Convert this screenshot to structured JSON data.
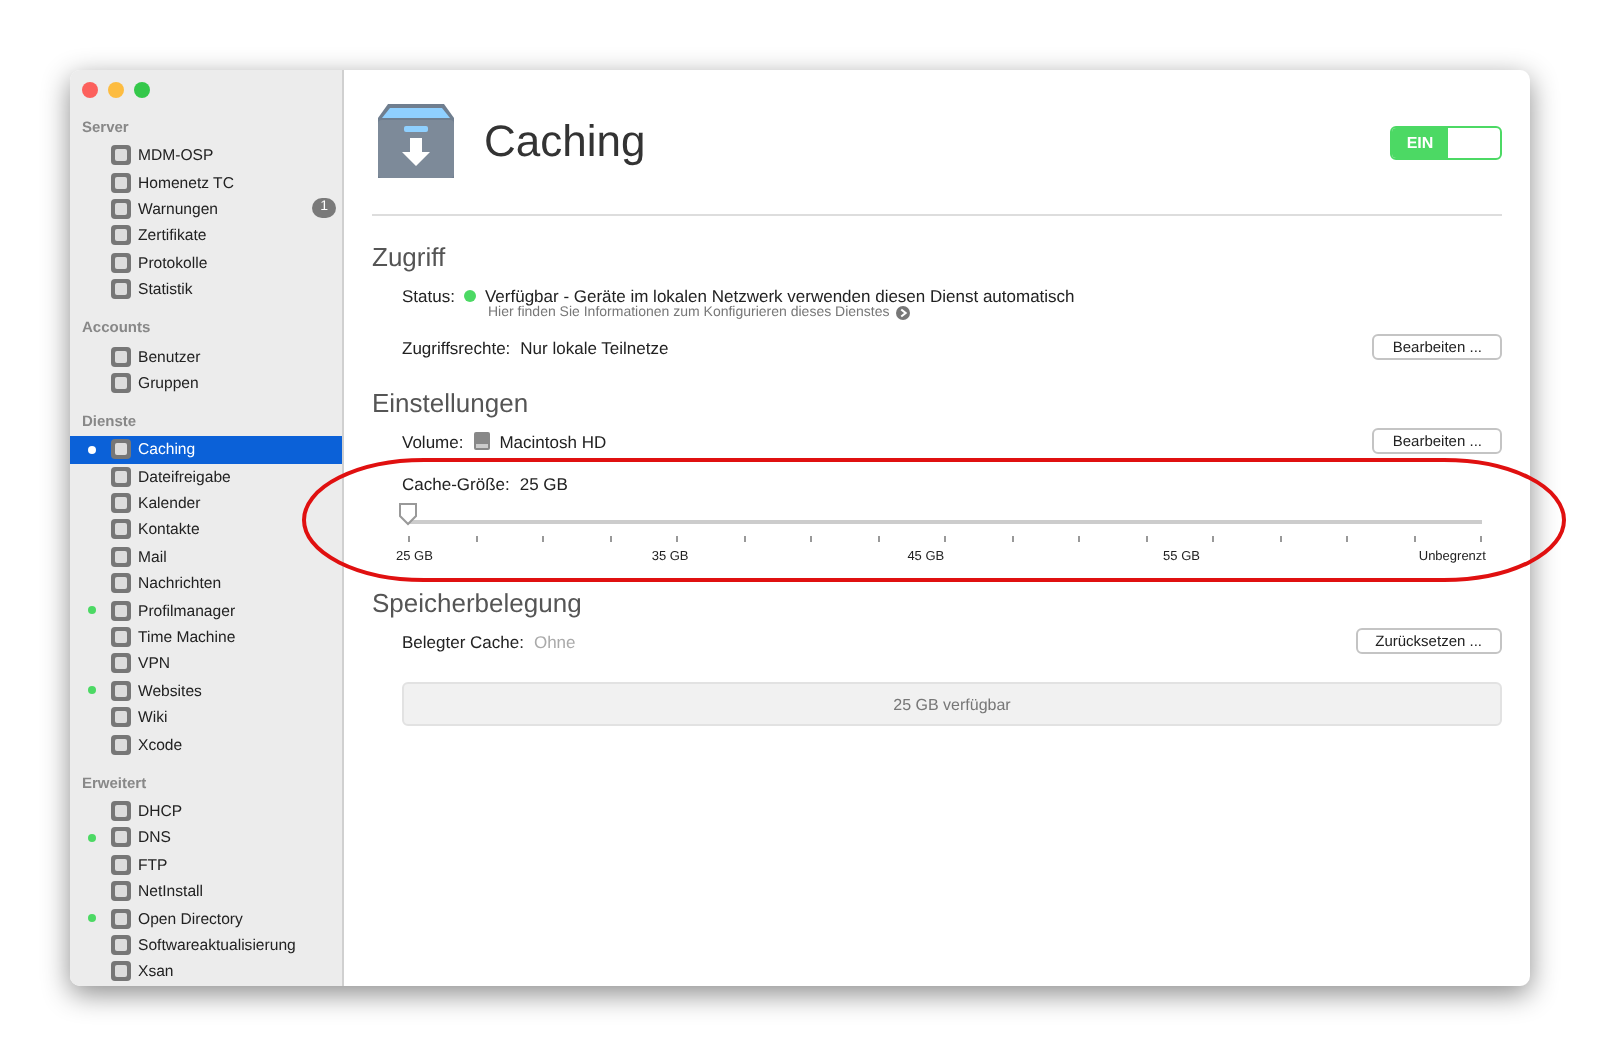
{
  "sidebar": {
    "sections": [
      {
        "title": "Server",
        "items": [
          {
            "label": "MDM-OSP",
            "selected": false,
            "running": false
          },
          {
            "label": "Homenetz TC",
            "selected": false,
            "running": false
          },
          {
            "label": "Warnungen",
            "selected": false,
            "running": false,
            "badge": "1"
          },
          {
            "label": "Zertifikate",
            "selected": false,
            "running": false
          },
          {
            "label": "Protokolle",
            "selected": false,
            "running": false
          },
          {
            "label": "Statistik",
            "selected": false,
            "running": false
          }
        ]
      },
      {
        "title": "Accounts",
        "items": [
          {
            "label": "Benutzer",
            "selected": false,
            "running": false
          },
          {
            "label": "Gruppen",
            "selected": false,
            "running": false
          }
        ]
      },
      {
        "title": "Dienste",
        "items": [
          {
            "label": "Caching",
            "selected": true,
            "running": true
          },
          {
            "label": "Dateifreigabe",
            "selected": false,
            "running": false
          },
          {
            "label": "Kalender",
            "selected": false,
            "running": false
          },
          {
            "label": "Kontakte",
            "selected": false,
            "running": false
          },
          {
            "label": "Mail",
            "selected": false,
            "running": false
          },
          {
            "label": "Nachrichten",
            "selected": false,
            "running": false
          },
          {
            "label": "Profilmanager",
            "selected": false,
            "running": true
          },
          {
            "label": "Time Machine",
            "selected": false,
            "running": false
          },
          {
            "label": "VPN",
            "selected": false,
            "running": false
          },
          {
            "label": "Websites",
            "selected": false,
            "running": true
          },
          {
            "label": "Wiki",
            "selected": false,
            "running": false
          },
          {
            "label": "Xcode",
            "selected": false,
            "running": false
          }
        ]
      },
      {
        "title": "Erweitert",
        "items": [
          {
            "label": "DHCP",
            "selected": false,
            "running": false
          },
          {
            "label": "DNS",
            "selected": false,
            "running": true
          },
          {
            "label": "FTP",
            "selected": false,
            "running": false
          },
          {
            "label": "NetInstall",
            "selected": false,
            "running": false
          },
          {
            "label": "Open Directory",
            "selected": false,
            "running": true
          },
          {
            "label": "Softwareaktualisierung",
            "selected": false,
            "running": false
          },
          {
            "label": "Xsan",
            "selected": false,
            "running": false
          }
        ]
      }
    ]
  },
  "header": {
    "title": "Caching",
    "toggle": {
      "label": "EIN",
      "on": true
    }
  },
  "access": {
    "title": "Zugriff",
    "status_label": "Status:",
    "status_text": "Verfügbar - Geräte im lokalen Netzwerk verwenden diesen Dienst automatisch",
    "status_ok": true,
    "help": "Hier finden Sie Informationen zum Konfigurieren dieses Dienstes",
    "rights_label": "Zugriffsrechte:",
    "rights_value": "Nur lokale Teilnetze",
    "edit_button": "Bearbeiten ..."
  },
  "settings": {
    "title": "Einstellungen",
    "volume_label": "Volume:",
    "volume_value": "Macintosh HD",
    "edit_button": "Bearbeiten ...",
    "cache_label": "Cache-Größe:",
    "cache_value": "25 GB",
    "cache_size": {
      "level": 0,
      "tick_labels": [
        "25 GB",
        "35 GB",
        "45 GB",
        "55 GB",
        "Unbegrenzt"
      ]
    }
  },
  "storage": {
    "title": "Speicherbelegung",
    "used_label": "Belegter Cache:",
    "used_value": "Ohne",
    "reset_button": "Zurücksetzen ...",
    "bar_text": "25 GB verfügbar"
  }
}
